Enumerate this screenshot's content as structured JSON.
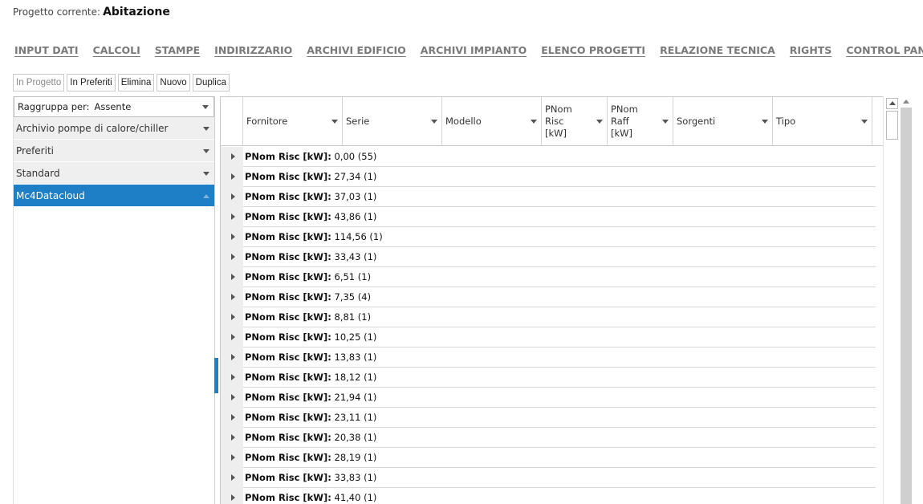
{
  "project": {
    "label": "Progetto corrente:",
    "name": "Abitazione"
  },
  "menu": [
    {
      "label": "INPUT DATI"
    },
    {
      "label": "CALCOLI"
    },
    {
      "label": "STAMPE"
    },
    {
      "label": "INDIRIZZARIO"
    },
    {
      "label": "ARCHIVI EDIFICIO"
    },
    {
      "label": "ARCHIVI IMPIANTO"
    },
    {
      "label": "ELENCO PROGETTI"
    },
    {
      "label": "RELAZIONE TECNICA"
    },
    {
      "label": "RIGHTS"
    },
    {
      "label": "CONTROL PANEL"
    }
  ],
  "toolbar": {
    "in_progetto": "In Progetto",
    "in_preferiti": "In Preferiti",
    "elimina": "Elimina",
    "nuovo": "Nuovo",
    "duplica": "Duplica"
  },
  "sidebar": {
    "group_by_label": "Raggruppa per:",
    "group_by_value": "Assente",
    "items": [
      {
        "label": "Archivio pompe di calore/chiller"
      },
      {
        "label": "Preferiti"
      },
      {
        "label": "Standard"
      },
      {
        "label": "Mc4Datacloud"
      }
    ]
  },
  "grid": {
    "columns": [
      {
        "label": "Fornitore"
      },
      {
        "label": "Serie"
      },
      {
        "label": "Modello"
      },
      {
        "label": "PNom Risc [kW]",
        "lines": [
          "PNom",
          "Risc",
          "[kW]"
        ]
      },
      {
        "label": "PNom Raff [kW]",
        "lines": [
          "PNom",
          "Raff",
          "[kW]"
        ]
      },
      {
        "label": "Sorgenti"
      },
      {
        "label": "Tipo"
      }
    ],
    "group_prefix": "PNom Risc [kW]:",
    "rows": [
      {
        "value": "0,00 (55)"
      },
      {
        "value": "27,34 (1)"
      },
      {
        "value": "37,03 (1)"
      },
      {
        "value": "43,86 (1)"
      },
      {
        "value": "114,56 (1)"
      },
      {
        "value": "33,43 (1)"
      },
      {
        "value": "6,51 (1)"
      },
      {
        "value": "7,35 (4)"
      },
      {
        "value": "8,81 (1)"
      },
      {
        "value": "10,25 (1)"
      },
      {
        "value": "13,83 (1)"
      },
      {
        "value": "18,12 (1)"
      },
      {
        "value": "21,94 (1)"
      },
      {
        "value": "23,11 (1)"
      },
      {
        "value": "20,38 (1)"
      },
      {
        "value": "28,19 (1)"
      },
      {
        "value": "33,83 (1)"
      },
      {
        "value": "41,40 (1)"
      }
    ]
  }
}
